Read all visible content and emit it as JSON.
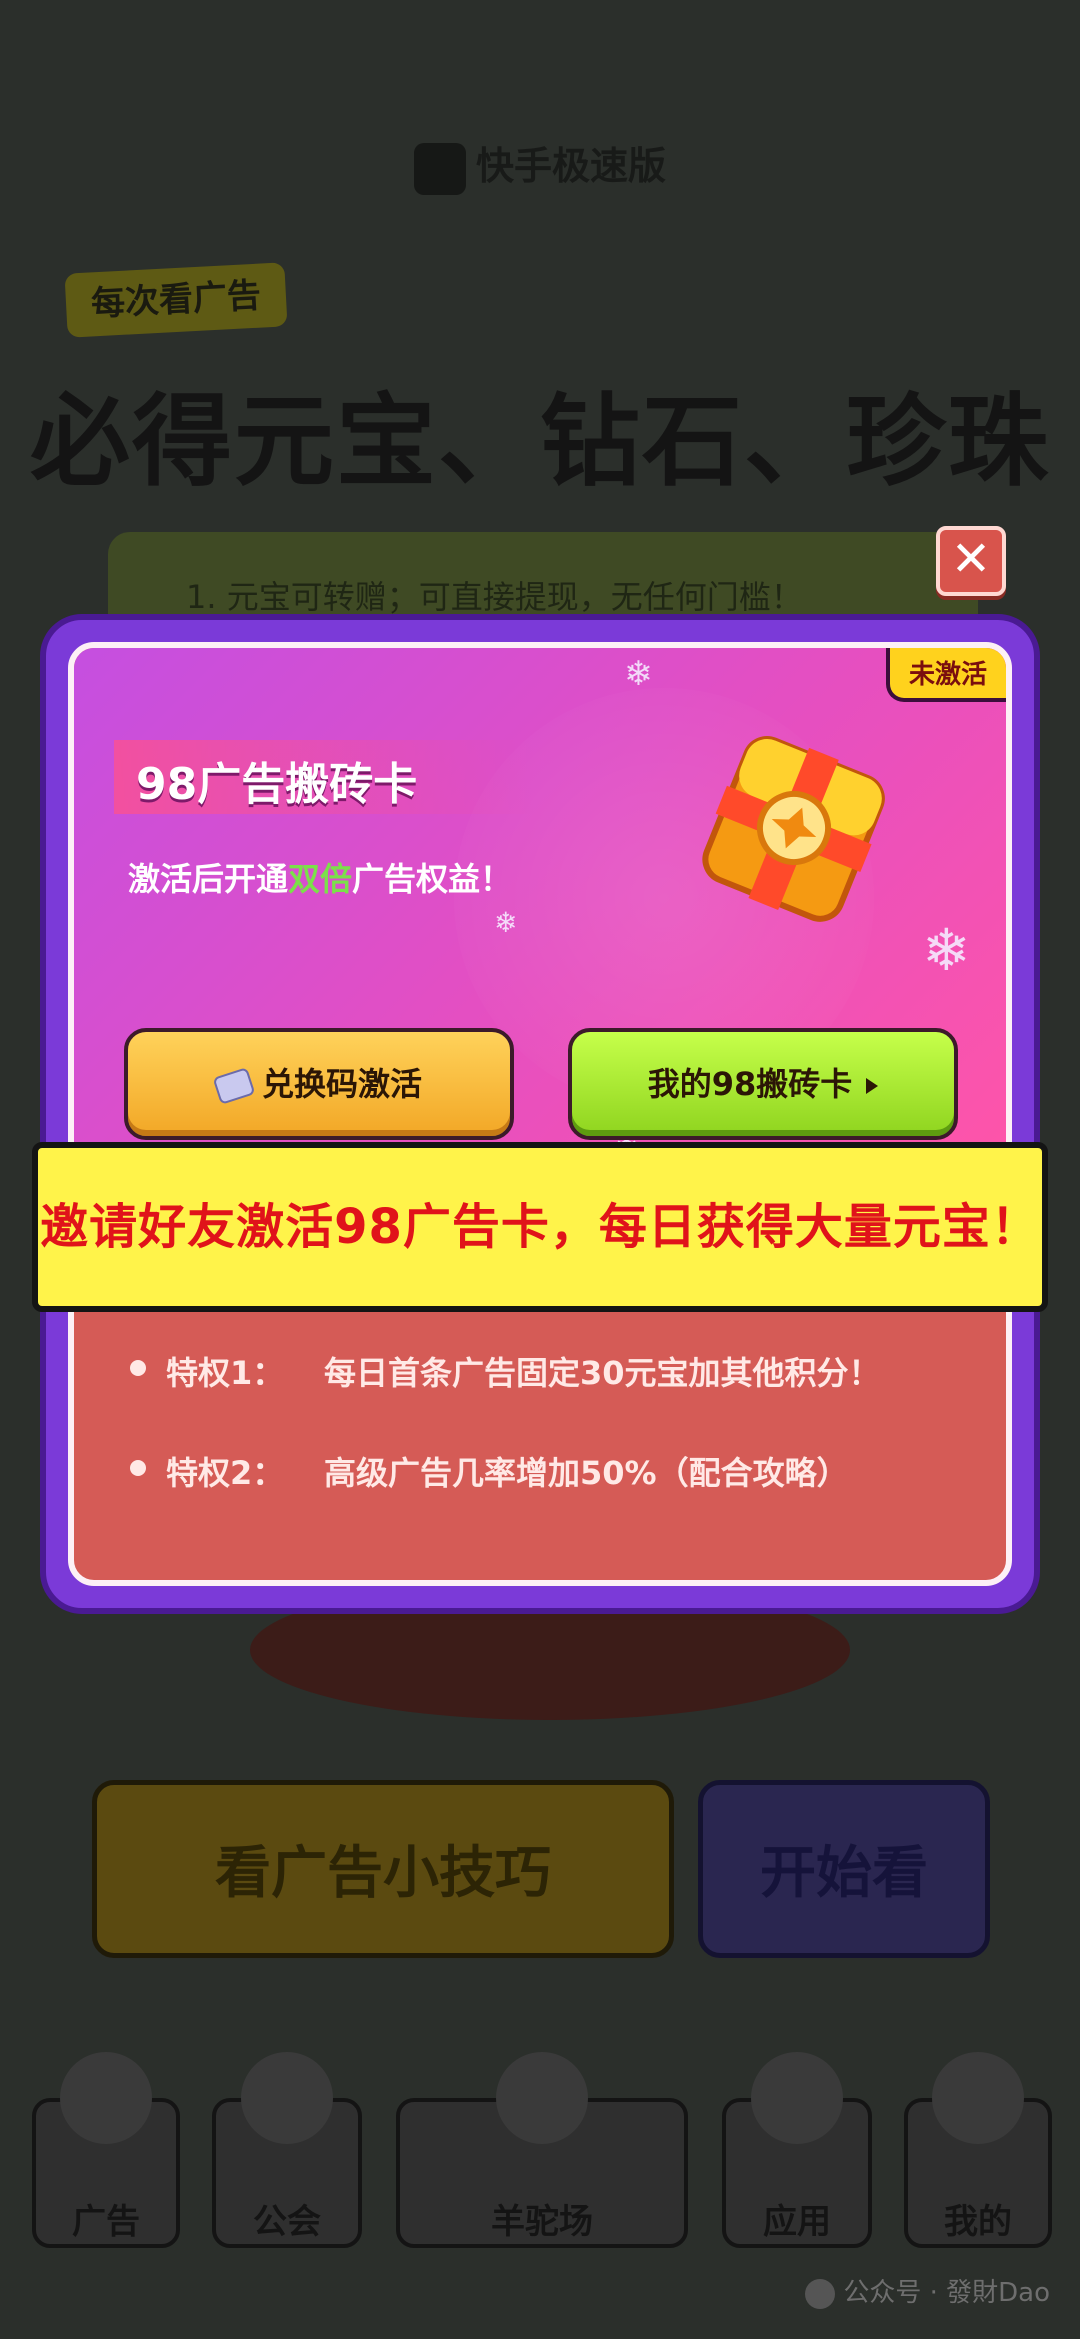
{
  "background": {
    "brand": "快手极速版",
    "tag": "每次看广告",
    "headline": "必得元宝、钻石、珍珠",
    "rule_line": "1. 元宝可转赠；可直接提现，无任何门槛！",
    "tips_button": "看广告小技巧",
    "start_button": "开始看",
    "nav": [
      {
        "label": "广告",
        "icon": "wheel-icon"
      },
      {
        "label": "公会",
        "icon": "shield-icon"
      },
      {
        "label": "羊驼场",
        "icon": "alpaca-icon"
      },
      {
        "label": "应用",
        "icon": "app-icon"
      },
      {
        "label": "我的",
        "icon": "avatar-icon"
      }
    ]
  },
  "modal": {
    "close_label": "✕",
    "status_badge": "未激活",
    "title": "98广告搬砖卡",
    "subtitle_prefix": "激活后开通",
    "subtitle_highlight": "双倍",
    "subtitle_suffix": "广告权益！",
    "redeem_button": "兑换码激活",
    "my_card_button": "我的98搬砖卡",
    "banner": "邀请好友激活98广告卡，每日获得大量元宝！",
    "privileges": [
      {
        "label": "特权1：",
        "text": "每日首条广告固定30元宝加其他积分！"
      },
      {
        "label": "特权2：",
        "text": "高级广告几率增加50%（配合攻略）"
      }
    ]
  },
  "watermark": "公众号 · 發財Dao",
  "colors": {
    "modal_purple": "#7b3ad8",
    "banner_yellow": "#fff34a",
    "banner_text": "#e0131a",
    "close_red": "#d8544c",
    "highlight_green": "#7be04a"
  }
}
